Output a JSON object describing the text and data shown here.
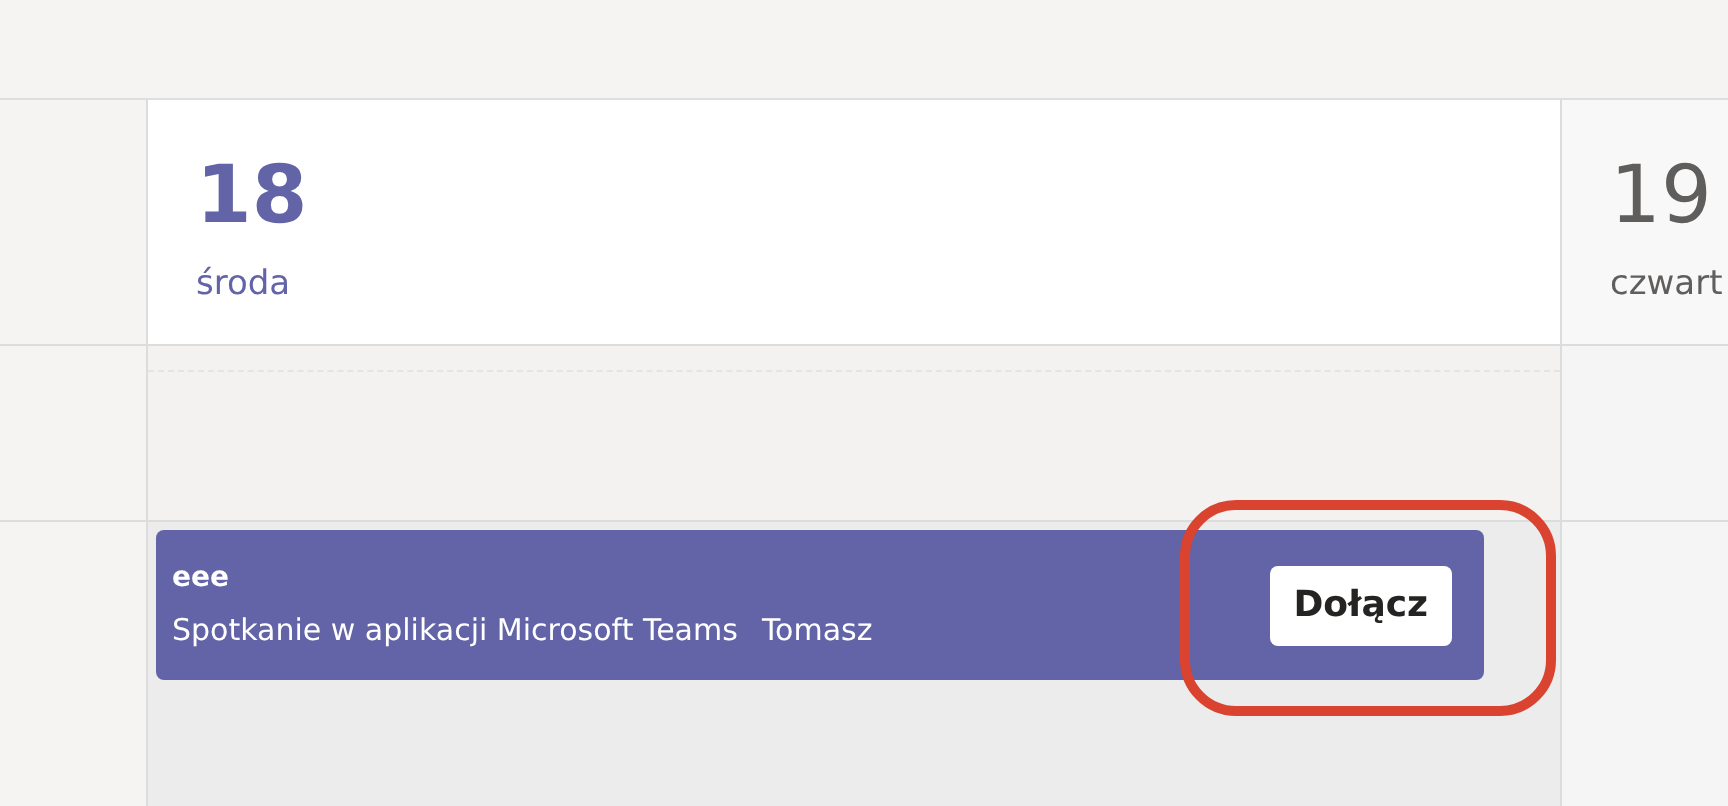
{
  "days": [
    {
      "number": "18",
      "weekday": "środa",
      "selected": true
    },
    {
      "number": "19",
      "weekday": "czwart",
      "selected": false
    }
  ],
  "event": {
    "title": "eee",
    "location": "Spotkanie w aplikacji Microsoft Teams",
    "organizer": "Tomasz",
    "join_button": "Dołącz",
    "highlighted": true
  }
}
